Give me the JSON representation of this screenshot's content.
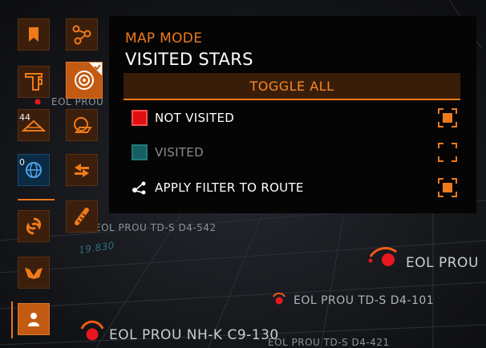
{
  "map": {
    "labels": {
      "eol_prou_tl": "EOL PROU",
      "td_s_d4_542": "EOL PROU TD-S D4-542",
      "dist_19830": "19.830",
      "eol_prou_right": "EOL PROU",
      "td_s_d4_101": "EOL PROU TD-S D4-101",
      "nh_k_c9_130": "EOL PROU NH-K C9-130",
      "td_s_d4_421": "EOL PROU TD-S D4-421"
    }
  },
  "toolbar": {
    "counts": {
      "stars": "44",
      "globe": "0"
    }
  },
  "panel": {
    "mode_label": "MAP MODE",
    "title": "VISITED STARS",
    "toggle_all_label": "TOGGLE ALL",
    "rows": [
      {
        "label": "NOT VISITED",
        "swatch_color": "#e01010",
        "checked": true,
        "dim": false
      },
      {
        "label": "VISITED",
        "swatch_color": "#1f7d80",
        "checked": false,
        "dim": true
      },
      {
        "label": "APPLY FILTER TO ROUTE",
        "checked": true,
        "dim": false
      }
    ]
  },
  "colors": {
    "accent": "#f07a1a",
    "star_red": "#e8161e"
  }
}
